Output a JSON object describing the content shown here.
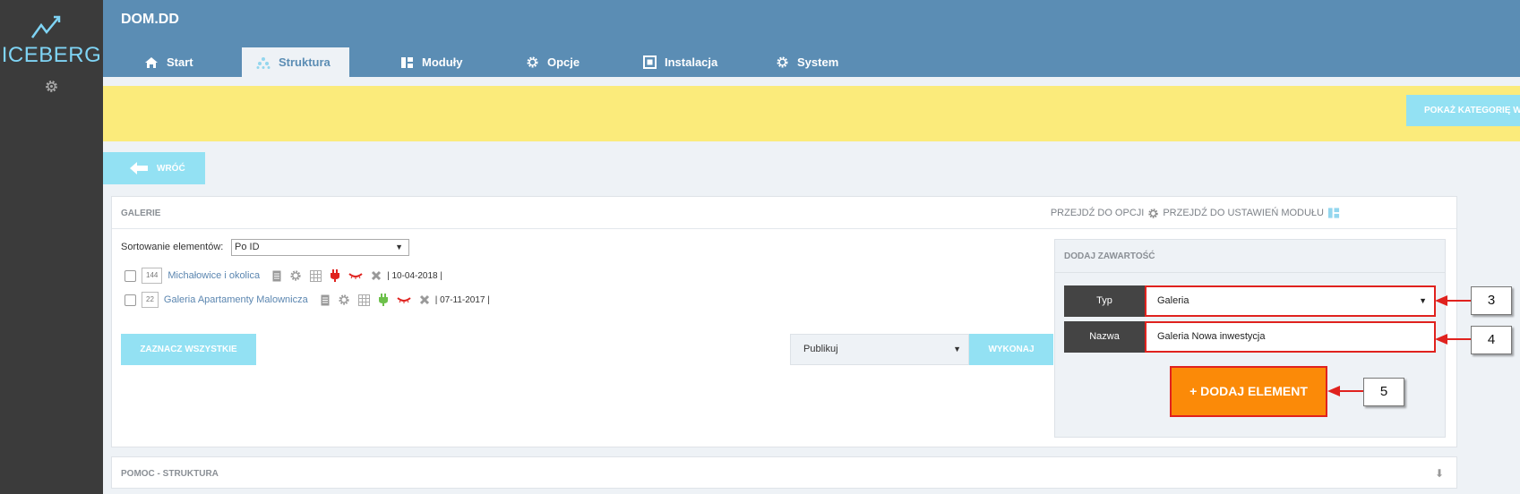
{
  "sidebar": {
    "logo_text": "ICEBERG"
  },
  "header": {
    "site_title": "DOM.DD",
    "tabs": [
      {
        "label": "Start",
        "icon": "home-icon"
      },
      {
        "label": "Struktura",
        "icon": "structure-icon",
        "active": true
      },
      {
        "label": "Moduły",
        "icon": "modules-icon"
      },
      {
        "label": "Opcje",
        "icon": "gear-icon"
      },
      {
        "label": "Instalacja",
        "icon": "installation-icon"
      },
      {
        "label": "System",
        "icon": "gear-icon"
      }
    ]
  },
  "banner": {
    "category_button": "POKAŻ KATEGORIĘ W"
  },
  "toolbar": {
    "back_label": "WRÓĆ"
  },
  "panel": {
    "title": "GALERIE",
    "link_options": "PRZEJDŹ DO OPCJI",
    "link_module_settings": "PRZEJDŹ DO USTAWIEŃ MODUŁU",
    "sort_label": "Sortowanie elementów:",
    "sort_value": "Po ID",
    "rows": [
      {
        "id": "144",
        "name": "Michałowice i okolica",
        "date": "| 10-04-2018 |",
        "status_color": "#e0221e"
      },
      {
        "id": "22",
        "name": "Galeria Apartamenty Malownicza",
        "date": "| 07-11-2017 |",
        "status_color": "#6cc04a"
      }
    ],
    "select_all_label": "ZAZNACZ WSZYSTKIE",
    "action_value": "Publikuj",
    "execute_label": "WYKONAJ"
  },
  "add_content": {
    "title": "DODAJ ZAWARTOŚĆ",
    "type_label": "Typ",
    "type_value": "Galeria",
    "name_label": "Nazwa",
    "name_value": "Galeria Nowa inwestycja",
    "add_button": "+ DODAJ ELEMENT"
  },
  "help": {
    "title": "POMOC - STRUKTURA"
  },
  "callouts": {
    "c3": "3",
    "c4": "4",
    "c5": "5"
  },
  "colors": {
    "accent": "#5b8db4",
    "light_button": "#93e1f3",
    "banner": "#fbeb7b",
    "primary_action": "#fb8a08",
    "highlight": "#e0221e"
  }
}
